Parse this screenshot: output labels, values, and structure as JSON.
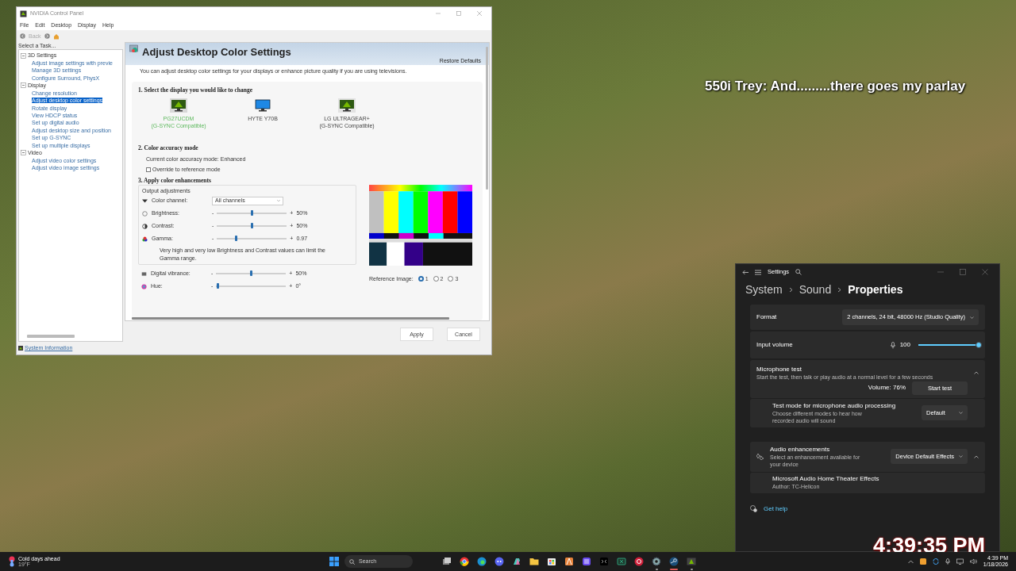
{
  "overlay": {
    "chat": "550i Trey: And.........there goes my parlay",
    "clock": "4:39:35 PM"
  },
  "nvidia_window": {
    "title": "NVIDIA Control Panel",
    "menu": [
      "File",
      "Edit",
      "Desktop",
      "Display",
      "Help"
    ],
    "toolbar": {
      "back_label": "Back",
      "back_disabled": true
    },
    "task_label": "Select a Task...",
    "tree": [
      {
        "label": "3D Settings",
        "expanded": true,
        "children": [
          {
            "label": "Adjust image settings with previe",
            "selected": false
          },
          {
            "label": "Manage 3D settings",
            "selected": false
          },
          {
            "label": "Configure Surround, PhysX",
            "selected": false
          }
        ]
      },
      {
        "label": "Display",
        "expanded": true,
        "children": [
          {
            "label": "Change resolution",
            "selected": false
          },
          {
            "label": "Adjust desktop color settings",
            "selected": true
          },
          {
            "label": "Rotate display",
            "selected": false
          },
          {
            "label": "View HDCP status",
            "selected": false
          },
          {
            "label": "Set up digital audio",
            "selected": false
          },
          {
            "label": "Adjust desktop size and position",
            "selected": false
          },
          {
            "label": "Set up G-SYNC",
            "selected": false
          },
          {
            "label": "Set up multiple displays",
            "selected": false
          }
        ]
      },
      {
        "label": "Video",
        "expanded": true,
        "children": [
          {
            "label": "Adjust video color settings",
            "selected": false
          },
          {
            "label": "Adjust video image settings",
            "selected": false
          }
        ]
      }
    ],
    "system_info": "System Information",
    "page": {
      "title": "Adjust Desktop Color Settings",
      "restore": "Restore Defaults",
      "description": "You can adjust desktop color settings for your displays or enhance picture quality if you are using televisions.",
      "section1": "1. Select the display you would like to change",
      "displays": [
        {
          "kind": "gsync",
          "name": "PG27UCDM",
          "subtitle": "(G-SYNC Compatible)",
          "selected": true
        },
        {
          "kind": "standard",
          "name": "HYTE Y70B",
          "selected": false
        },
        {
          "kind": "gsync",
          "name": "LG ULTRAGEAR+",
          "subtitle": "(G-SYNC Compatible)",
          "selected": false
        }
      ],
      "section2": "2. Color accuracy mode",
      "mode_text": "Current color accuracy mode: Enhanced",
      "override": {
        "label": "Override to reference mode",
        "checked": false
      },
      "section3": "3. Apply color enhancements",
      "group_label": "Output adjustments",
      "channel": {
        "label": "Color channel:",
        "value": "All channels"
      },
      "sliders": [
        {
          "label": "Brightness:",
          "min": "-",
          "max": "+",
          "level": 0.5,
          "reading": "50%"
        },
        {
          "label": "Contrast:",
          "min": "-",
          "max": "+",
          "level": 0.5,
          "reading": "50%"
        },
        {
          "label": "Gamma:",
          "min": "-",
          "max": "+",
          "level": 0.28,
          "reading": "0.97"
        }
      ],
      "note": "Very high and very low Brightness and Contrast values can limit the Gamma range.",
      "sliders2": [
        {
          "label": "Digital vibrance:",
          "min": "-",
          "max": "+",
          "level": 0.5,
          "reading": "50%"
        },
        {
          "label": "Hue:",
          "min": "-",
          "max": "+",
          "level": 0.03,
          "reading": "0°"
        }
      ],
      "reference_label": "Reference Image:",
      "reference_options": [
        {
          "label": "1",
          "selected": true
        },
        {
          "label": "2",
          "selected": false
        },
        {
          "label": "3",
          "selected": false
        }
      ]
    },
    "buttons": [
      "Apply",
      "Cancel"
    ]
  },
  "settings_window": {
    "title": "Settings",
    "breadcrumb": [
      "System",
      "Sound",
      "Properties"
    ],
    "format": {
      "label": "Format",
      "value": "2 channels, 24 bit, 48000 Hz (Studio Quality)"
    },
    "input_volume": {
      "label": "Input volume",
      "reading": "100",
      "level": 1.0
    },
    "mic_test": {
      "title": "Microphone test",
      "description": "Start the test, then talk or play audio at a normal level for a few seconds",
      "expanded": true,
      "volume": "Volume: 76%",
      "button": "Start test"
    },
    "test_mode": {
      "title": "Test mode for microphone audio processing",
      "description": "Choose different modes to hear how recorded audio will sound",
      "value": "Default"
    },
    "enhancements": {
      "title": "Audio enhancements",
      "description": "Select an enhancement available for your device",
      "value": "Device Default Effects",
      "expanded": true
    },
    "effect": {
      "title": "Microsoft Audio Home Theater Effects",
      "author": "Author: TC-Helicon"
    },
    "get_help": "Get help"
  },
  "taskbar": {
    "weather": {
      "title": "Cold days ahead",
      "temp": "19°F"
    },
    "search": {
      "placeholder": "Search"
    },
    "apps": [
      {
        "kind": "taskview",
        "selected": false,
        "running": false
      },
      {
        "kind": "chrome",
        "selected": false,
        "running": false
      },
      {
        "kind": "edge",
        "selected": false,
        "running": false
      },
      {
        "kind": "discord",
        "selected": false,
        "running": false
      },
      {
        "kind": "copilot",
        "selected": false,
        "running": false
      },
      {
        "kind": "folder",
        "selected": false,
        "running": false
      },
      {
        "kind": "store",
        "selected": false,
        "running": false
      },
      {
        "kind": "orange",
        "selected": false,
        "running": false
      },
      {
        "kind": "grid",
        "selected": false,
        "running": false
      },
      {
        "kind": "terminal",
        "selected": false,
        "running": false
      },
      {
        "kind": "sheet",
        "selected": false,
        "running": false
      },
      {
        "kind": "red",
        "selected": false,
        "running": false
      },
      {
        "kind": "gear",
        "selected": false,
        "running": true
      },
      {
        "kind": "steam",
        "selected": true,
        "running": true
      },
      {
        "kind": "nvidia",
        "selected": false,
        "running": true
      }
    ],
    "time": "4:39 PM",
    "date": "1/18/2026"
  }
}
